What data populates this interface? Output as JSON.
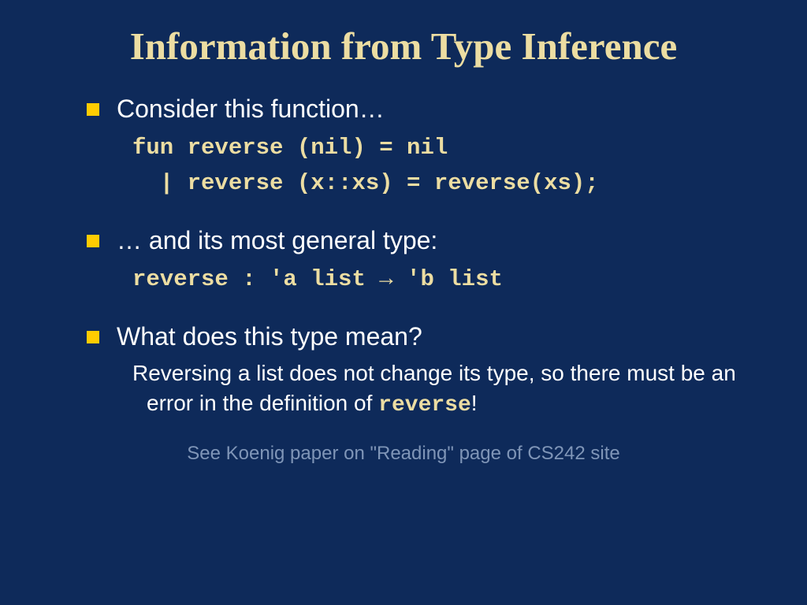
{
  "title": "Information from Type Inference",
  "bullet1": {
    "text": "Consider this function…",
    "code1": "fun reverse (nil) = nil",
    "code2": "  | reverse (x::xs) = reverse(xs);"
  },
  "bullet2": {
    "text": "… and its most general type:",
    "code": "reverse : 'a list → 'b list"
  },
  "bullet3": {
    "text": "What does this type mean?",
    "explain_pre": "Reversing a list does not change its type, so there must be an error in the definition of ",
    "explain_kw": "reverse",
    "explain_post": "!"
  },
  "footer": "See Koenig paper on \"Reading\" page of CS242 site"
}
